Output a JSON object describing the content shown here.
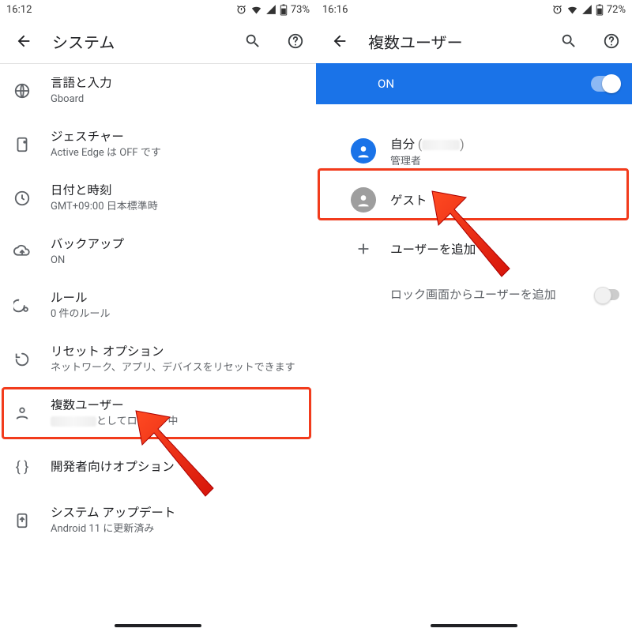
{
  "left": {
    "status": {
      "time": "16:12",
      "battery": "73%"
    },
    "title": "システム",
    "items": [
      {
        "title": "言語と入力",
        "sub": "Gboard"
      },
      {
        "title": "ジェスチャー",
        "sub": "Active Edge は OFF です"
      },
      {
        "title": "日付と時刻",
        "sub": "GMT+09:00 日本標準時"
      },
      {
        "title": "バックアップ",
        "sub": "ON"
      },
      {
        "title": "ルール",
        "sub": "0 件のルール"
      },
      {
        "title": "リセット オプション",
        "sub": "ネットワーク、アプリ、デバイスをリセットできます"
      },
      {
        "title": "複数ユーザー",
        "sub_suffix": "としてログイン中"
      },
      {
        "title": "開発者向けオプション",
        "sub": ""
      },
      {
        "title": "システム アップデート",
        "sub": "Android 11 に更新済み"
      }
    ]
  },
  "right": {
    "status": {
      "time": "16:16",
      "battery": "72%"
    },
    "title": "複数ユーザー",
    "switch_label": "ON",
    "users": {
      "self_label": "自分",
      "self_sub": "管理者",
      "guest_label": "ゲスト",
      "add_label": "ユーザーを追加"
    },
    "lock_label": "ロック画面からユーザーを追加"
  }
}
